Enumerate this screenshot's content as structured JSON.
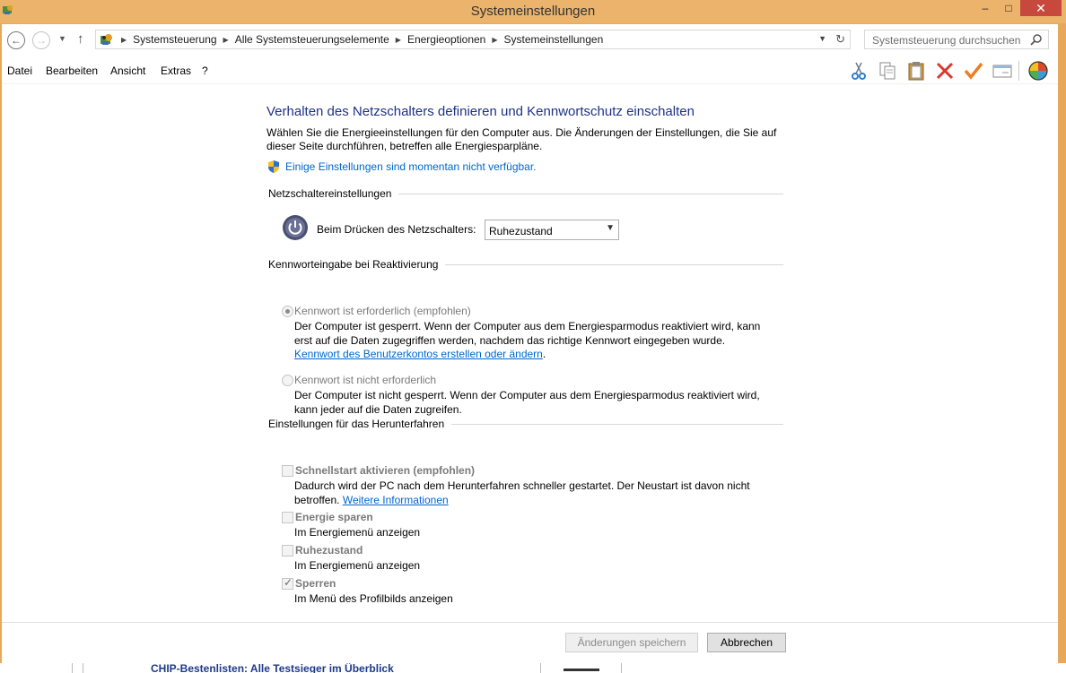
{
  "window": {
    "title": "Systemeinstellungen",
    "minimize_glyph": "–",
    "maximize_glyph": "□",
    "close_glyph": "✕"
  },
  "address": {
    "breadcrumb": [
      "Systemsteuerung",
      "Alle Systemsteuerungselemente",
      "Energieoptionen",
      "Systemeinstellungen"
    ],
    "search_placeholder": "Systemsteuerung durchsuchen"
  },
  "menu": {
    "items": [
      "Datei",
      "Bearbeiten",
      "Ansicht",
      "Extras",
      "?"
    ]
  },
  "toolbar": {
    "icons": [
      "scissors-icon",
      "copy-icon",
      "paste-icon",
      "delete-icon",
      "check-icon",
      "properties-icon",
      "color-wheel-icon"
    ]
  },
  "page": {
    "heading": "Verhalten des Netzschalters definieren und Kennwortschutz einschalten",
    "description": "Wählen Sie die Energieeinstellungen für den Computer aus. Die Änderungen der Einstellungen, die Sie auf dieser Seite durchführen, betreffen alle Energiesparpläne.",
    "unavailable_link": "Einige Einstellungen sind momentan nicht verfügbar."
  },
  "power_button": {
    "section_title": "Netzschaltereinstellungen",
    "label": "Beim Drücken des Netzschalters:",
    "selected": "Ruhezustand"
  },
  "password": {
    "section_title": "Kennworteingabe bei Reaktivierung",
    "option_required": {
      "label": "Kennwort ist erforderlich (empfohlen)",
      "checked": true,
      "description": "Der Computer ist gesperrt. Wenn der Computer aus dem Energiesparmodus reaktiviert wird, kann erst auf die Daten zugegriffen werden, nachdem das richtige Kennwort eingegeben wurde.",
      "link": "Kennwort des Benutzerkontos erstellen oder ändern",
      "link_suffix": "."
    },
    "option_not_required": {
      "label": "Kennwort ist nicht erforderlich",
      "checked": false,
      "description": "Der Computer ist nicht gesperrt. Wenn der Computer aus dem Energiesparmodus reaktiviert wird, kann jeder auf die Daten zugreifen."
    }
  },
  "shutdown": {
    "section_title": "Einstellungen für das Herunterfahren",
    "fast_startup": {
      "label": "Schnellstart aktivieren (empfohlen)",
      "checked": false,
      "description": "Dadurch wird der PC nach dem Herunterfahren schneller gestartet. Der Neustart ist davon nicht betroffen.",
      "link": "Weitere Informationen"
    },
    "sleep": {
      "label": "Energie sparen",
      "checked": false,
      "description": "Im Energiemenü anzeigen"
    },
    "hibernate": {
      "label": "Ruhezustand",
      "checked": false,
      "description": "Im Energiemenü anzeigen"
    },
    "lock": {
      "label": "Sperren",
      "checked": true,
      "description": "Im Menü des Profilbilds anzeigen"
    }
  },
  "footer": {
    "save_label": "Änderungen speichern",
    "cancel_label": "Abbrechen"
  },
  "background_peek": {
    "text": "CHIP-Bestenlisten: Alle Testsieger im Überblick"
  },
  "colors": {
    "titlebar": "#ebb36b",
    "close_button": "#c7483d",
    "heading": "#1e3287",
    "link": "#0066cc"
  }
}
